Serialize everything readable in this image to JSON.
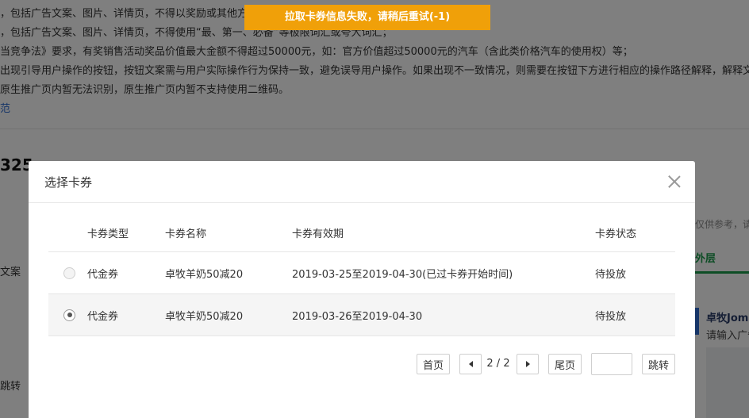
{
  "background": {
    "lines": [
      "，包括广告文案、图片、详情页，不得以奖励或其他方",
      "，包括广告文案、图片、详情页，不得使用“最、第一、必备”等极限词汇或夸大词汇；",
      "当竞争法》要求，有奖销售活动奖品价值最大金额不得超过50000元，如：官方价值超过50000元的汽车（含此类价格汽车的使用权）等；",
      "出现引导用户操作的按钮，按钮文案需与用户实际操作行为保持一致，避免误导用户操作。如果出现不一致情况，则需要在按钮下方进行相应的操作路径解释，解释文",
      "原生推广页内暂无法识别，原生推广页内暂不支持使用二维码。"
    ],
    "link": "范",
    "title_fragment": "325",
    "left_label_1": "文案",
    "left_label_2": "跳转",
    "right_hint": "仅供参考，请",
    "right_tab": "外层",
    "right_card_name": "卓牧Joma",
    "right_card_hint": "请输入广告"
  },
  "toast": {
    "text": "拉取卡券信息失败，请稍后重试(-1)"
  },
  "modal": {
    "title": "选择卡券",
    "columns": {
      "type": "卡券类型",
      "name": "卡券名称",
      "date": "卡券有效期",
      "status": "卡券状态"
    },
    "rows": [
      {
        "type": "代金券",
        "name": "卓牧羊奶50减20",
        "date": "2019-03-25至2019-04-30(已过卡券开始时间)",
        "status": "待投放",
        "checked": false
      },
      {
        "type": "代金券",
        "name": "卓牧羊奶50减20",
        "date": "2019-03-26至2019-04-30",
        "status": "待投放",
        "checked": true
      }
    ],
    "pager": {
      "first": "首页",
      "info": "2 / 2",
      "last": "尾页",
      "input_value": "",
      "jump": "跳转"
    }
  }
}
